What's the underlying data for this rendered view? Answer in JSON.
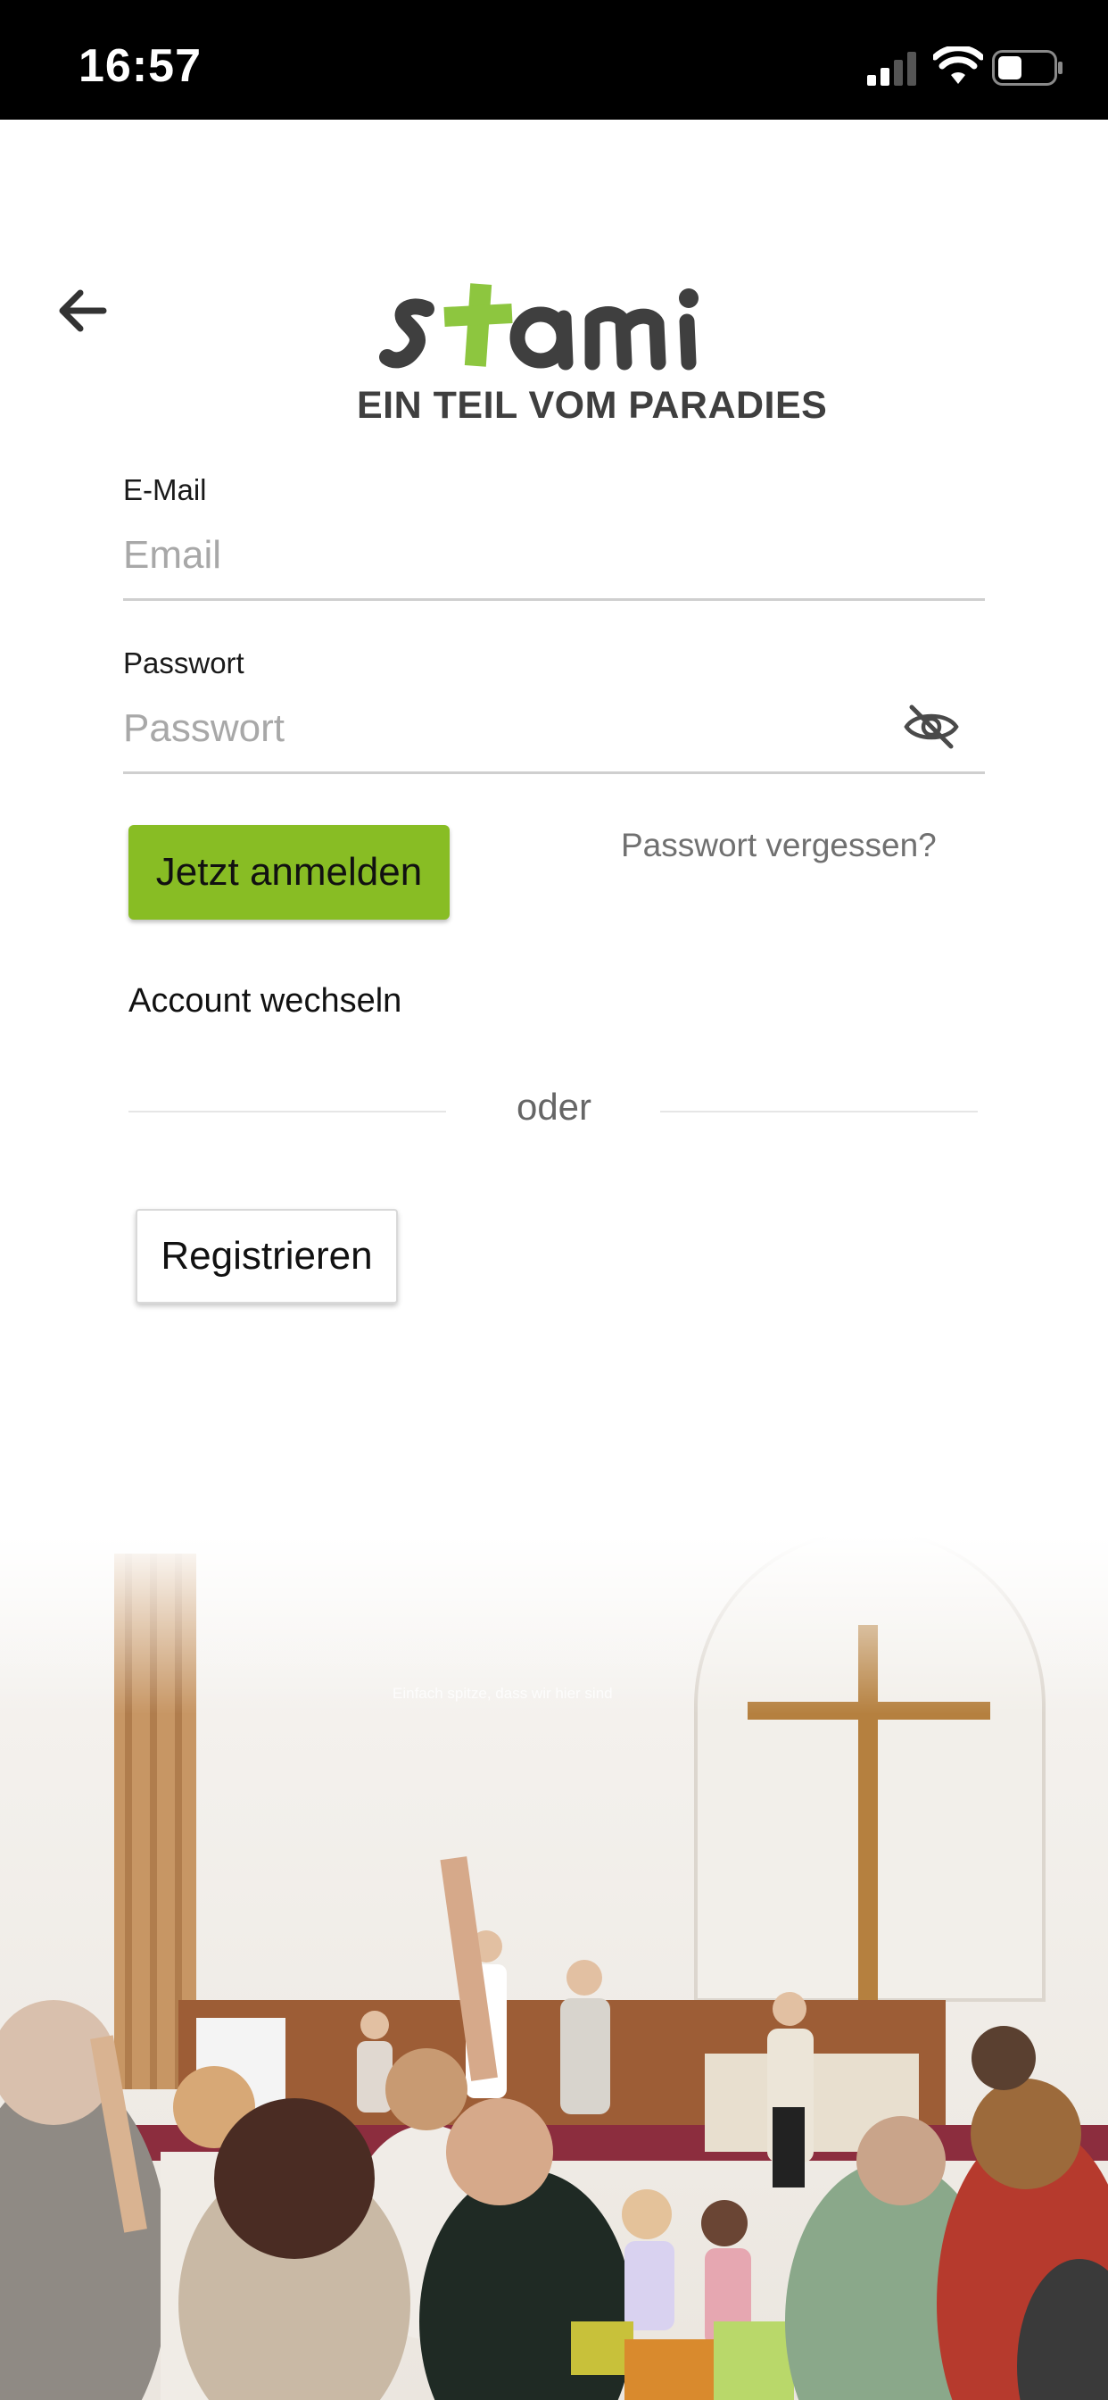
{
  "status_bar": {
    "time": "16:57",
    "icons": [
      "signal-icon",
      "wifi-icon",
      "battery-icon"
    ]
  },
  "header": {
    "back_icon": "arrow-left-icon",
    "logo_text": "stami",
    "tagline": "EIN TEIL VOM PARADIES"
  },
  "form": {
    "email": {
      "label": "E-Mail",
      "placeholder": "Email",
      "value": ""
    },
    "password": {
      "label": "Passwort",
      "placeholder": "Passwort",
      "value": "",
      "visibility_icon": "eye-slash-icon"
    },
    "login_button": "Jetzt anmelden",
    "forgot_password": "Passwort vergessen?",
    "switch_account": "Account wechseln",
    "divider": "oder",
    "register_button": "Registrieren"
  },
  "hero": {
    "image": "church-worship-photo",
    "projection_text": "Einfach spitze, dass wir hier sind"
  },
  "colors": {
    "accent": "#88bd24",
    "status_bar": "#000000",
    "logo_gray": "#3f3f3f",
    "cross_green": "#8dc63f",
    "muted_text": "#707070"
  }
}
